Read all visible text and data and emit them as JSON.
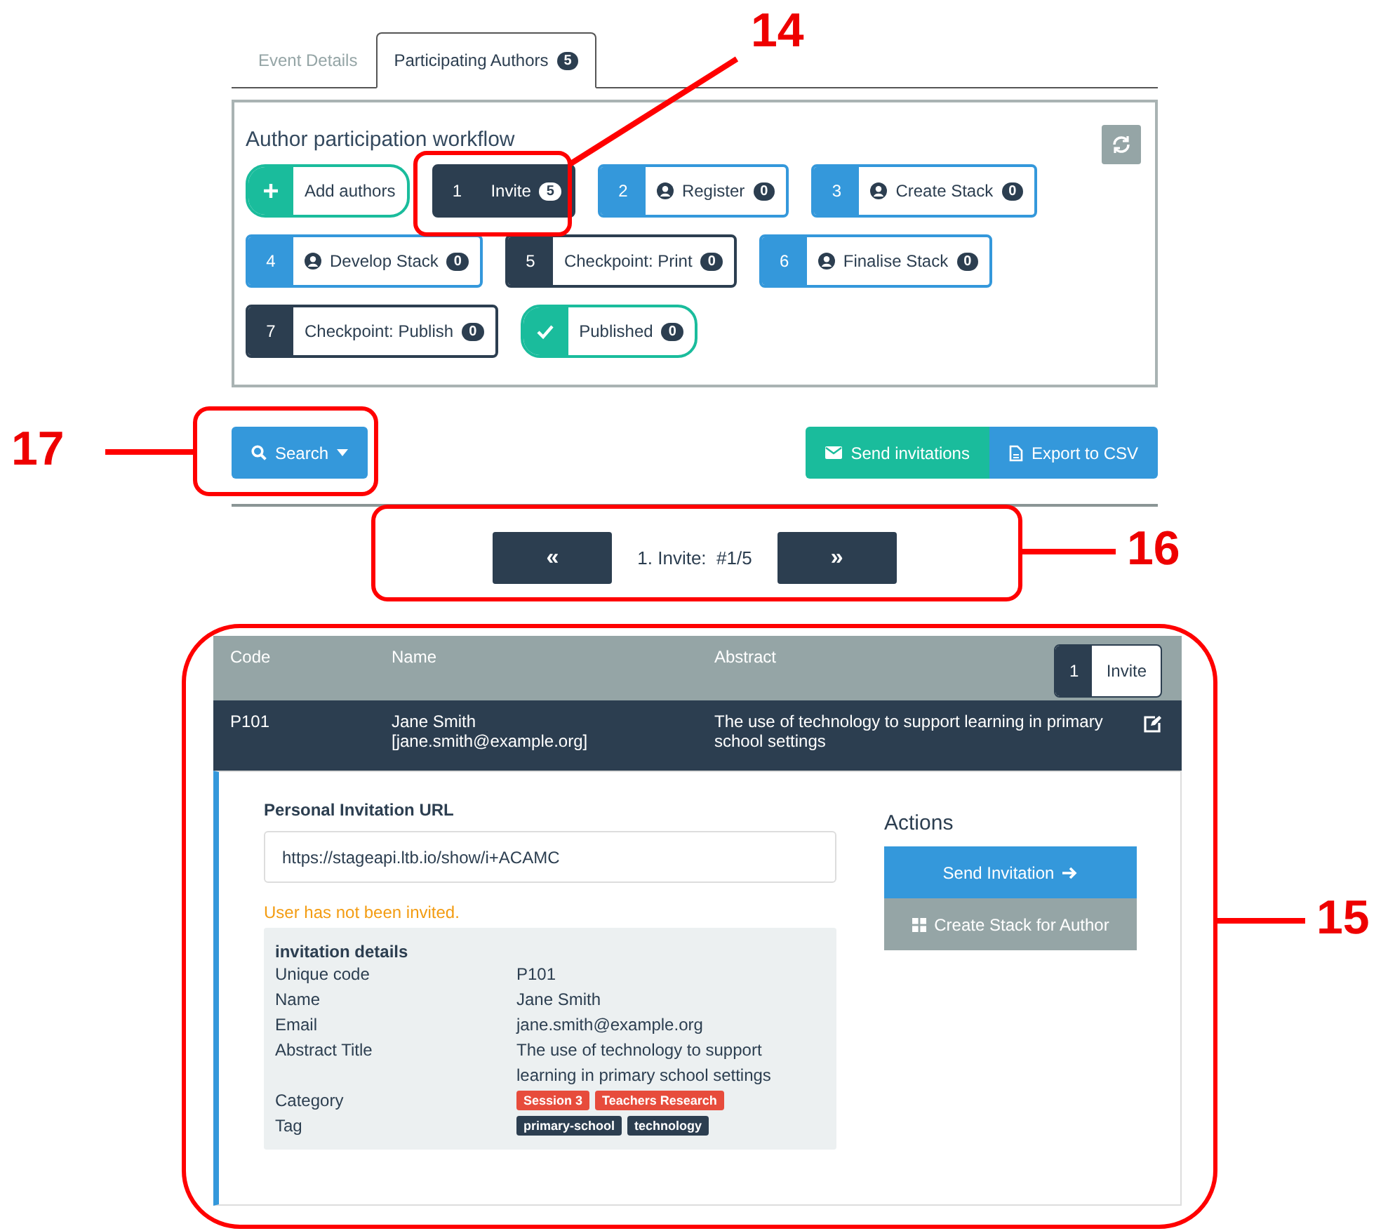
{
  "tabs": [
    {
      "label": "Event Details",
      "selected": false
    },
    {
      "label": "Participating Authors",
      "badge": "5",
      "selected": true
    }
  ],
  "workflow": {
    "title": "Author participation workflow",
    "steps": [
      {
        "kind": "add",
        "label": "Add authors",
        "color": "#1abc9c",
        "selected": false
      },
      {
        "kind": "step",
        "number": "1",
        "label": "Invite",
        "count": "5",
        "color": "#2c3e50",
        "person": false,
        "selected": true
      },
      {
        "kind": "step",
        "number": "2",
        "label": "Register",
        "count": "0",
        "color": "#3498db",
        "person": true,
        "selected": false
      },
      {
        "kind": "step",
        "number": "3",
        "label": "Create Stack",
        "count": "0",
        "color": "#3498db",
        "person": true,
        "selected": false
      },
      {
        "kind": "step",
        "number": "4",
        "label": "Develop Stack",
        "count": "0",
        "color": "#3498db",
        "person": true,
        "selected": false
      },
      {
        "kind": "step",
        "number": "5",
        "label": "Checkpoint: Print",
        "count": "0",
        "color": "#2c3e50",
        "person": false,
        "selected": false
      },
      {
        "kind": "step",
        "number": "6",
        "label": "Finalise Stack",
        "count": "0",
        "color": "#3498db",
        "person": true,
        "selected": false
      },
      {
        "kind": "step",
        "number": "7",
        "label": "Checkpoint: Publish",
        "count": "0",
        "color": "#2c3e50",
        "person": false,
        "selected": false
      },
      {
        "kind": "done",
        "label": "Published",
        "count": "0",
        "color": "#1abc9c",
        "selected": false
      }
    ]
  },
  "toolbar": {
    "search": "Search",
    "send": "Send invitations",
    "export": "Export to CSV"
  },
  "pager": {
    "prev": "«",
    "status": "1. Invite:  #1/5",
    "next": "»"
  },
  "table": {
    "columns": [
      "Code",
      "Name",
      "Abstract"
    ],
    "stage": {
      "number": "1",
      "label": "Invite"
    },
    "rows": [
      {
        "code": "P101",
        "name": "Jane Smith",
        "email": "[jane.smith@example.org]",
        "abstract": "The use of technology to support learning in primary school settings"
      }
    ]
  },
  "detail": {
    "url_label": "Personal Invitation URL",
    "url": "https://stageapi.ltb.io/show/i+ACAMC",
    "warning": "User has not been invited.",
    "details_title": "invitation details",
    "fields": [
      {
        "label": "Unique code",
        "value": "P101"
      },
      {
        "label": "Name",
        "value": "Jane Smith"
      },
      {
        "label": "Email",
        "value": "jane.smith@example.org"
      },
      {
        "label": "Abstract Title",
        "value": "The use of technology to support learning in primary school settings"
      },
      {
        "label": "Category",
        "tags": [
          {
            "label": "Session 3",
            "color": "#e74c3c"
          },
          {
            "label": "Teachers Research",
            "color": "#e74c3c"
          }
        ]
      },
      {
        "label": "Tag",
        "tags": [
          {
            "label": "primary-school",
            "color": "#2c3e50"
          },
          {
            "label": "technology",
            "color": "#2c3e50"
          }
        ]
      }
    ],
    "actions_title": "Actions",
    "actions": [
      {
        "kind": "send",
        "label": "Send Invitation"
      },
      {
        "kind": "create",
        "label": "Create Stack for Author"
      }
    ]
  },
  "annotations": [
    {
      "label": "14"
    },
    {
      "label": "17"
    },
    {
      "label": "16"
    },
    {
      "label": "15"
    }
  ]
}
